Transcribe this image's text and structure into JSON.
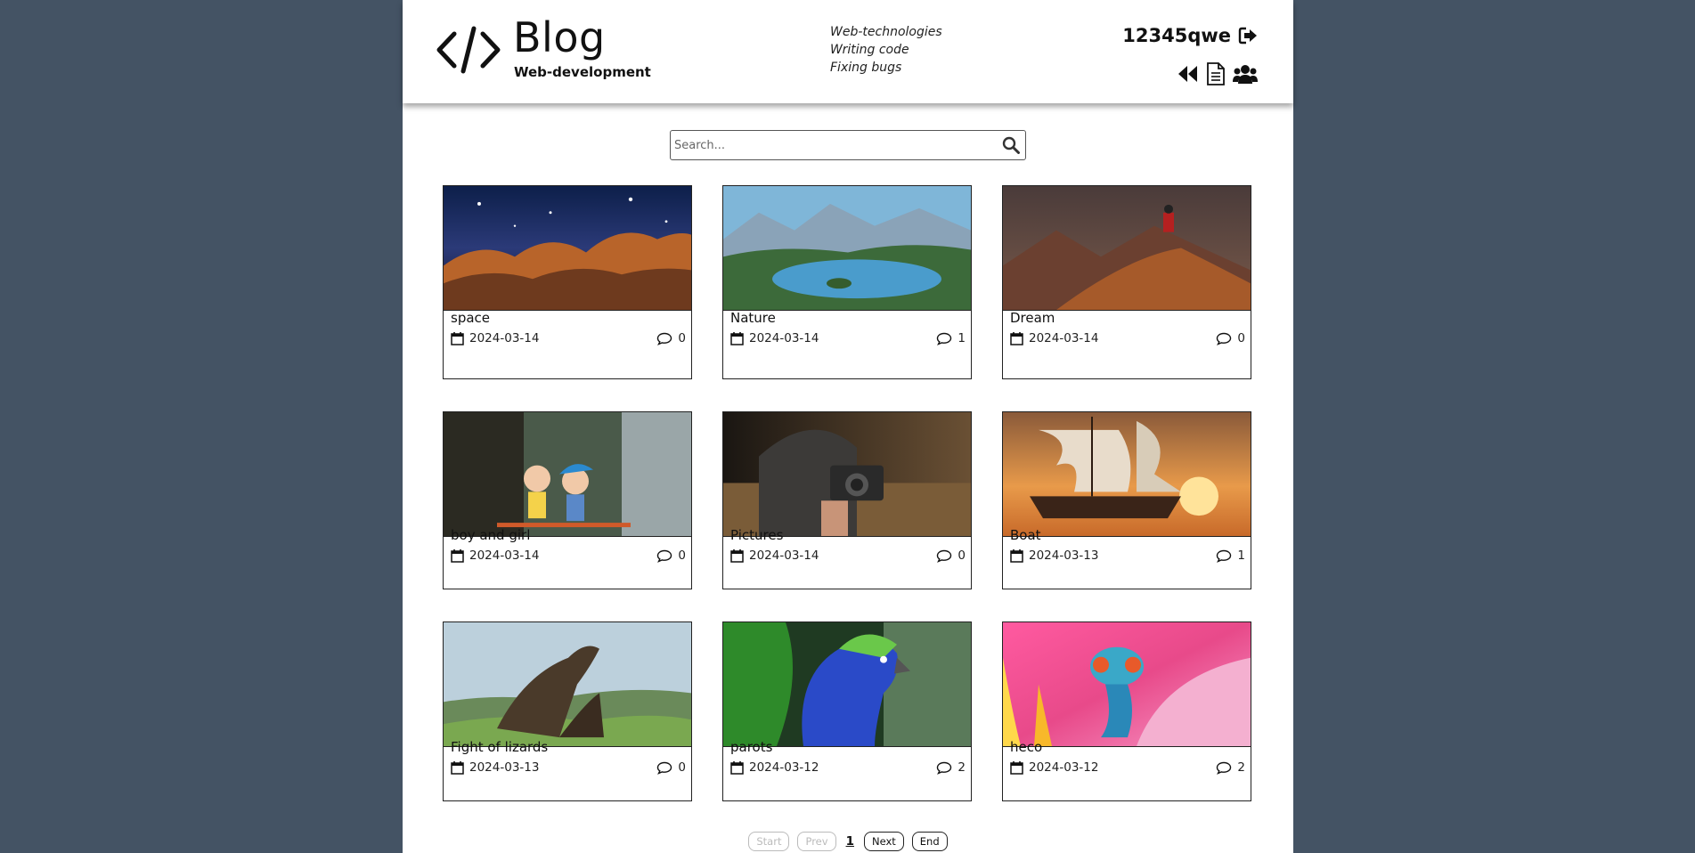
{
  "header": {
    "title": "Blog",
    "subtitle": "Web-development",
    "tagline": [
      "Web-technologies",
      "Writing code",
      "Fixing bugs"
    ],
    "username": "12345qwe",
    "icons": [
      "logout-icon",
      "back-icon",
      "document-icon",
      "users-icon"
    ]
  },
  "search": {
    "placeholder": "Search..."
  },
  "posts": [
    {
      "title": "space",
      "date": "2024-03-14",
      "comments": "0",
      "image": "space-nebula"
    },
    {
      "title": "Nature",
      "date": "2024-03-14",
      "comments": "1",
      "image": "mountain-lake"
    },
    {
      "title": "Dream",
      "date": "2024-03-14",
      "comments": "0",
      "image": "biker-on-mountain"
    },
    {
      "title": "boy and girl",
      "date": "2024-03-14",
      "comments": "0",
      "image": "toy-figures"
    },
    {
      "title": "Pictures",
      "date": "2024-03-14",
      "comments": "0",
      "image": "photographer"
    },
    {
      "title": "Boat",
      "date": "2024-03-13",
      "comments": "1",
      "image": "sailing-ship"
    },
    {
      "title": "Fight of lizards",
      "date": "2024-03-13",
      "comments": "0",
      "image": "komodo-lizards"
    },
    {
      "title": "parots",
      "date": "2024-03-12",
      "comments": "2",
      "image": "blue-parrot"
    },
    {
      "title": "heco",
      "date": "2024-03-12",
      "comments": "2",
      "image": "chameleon"
    }
  ],
  "pagination": {
    "start": "Start",
    "prev": "Prev",
    "current": "1",
    "next": "Next",
    "end": "End"
  },
  "colors": {
    "background": "#445364",
    "page": "#ffffff",
    "border": "#222222"
  }
}
